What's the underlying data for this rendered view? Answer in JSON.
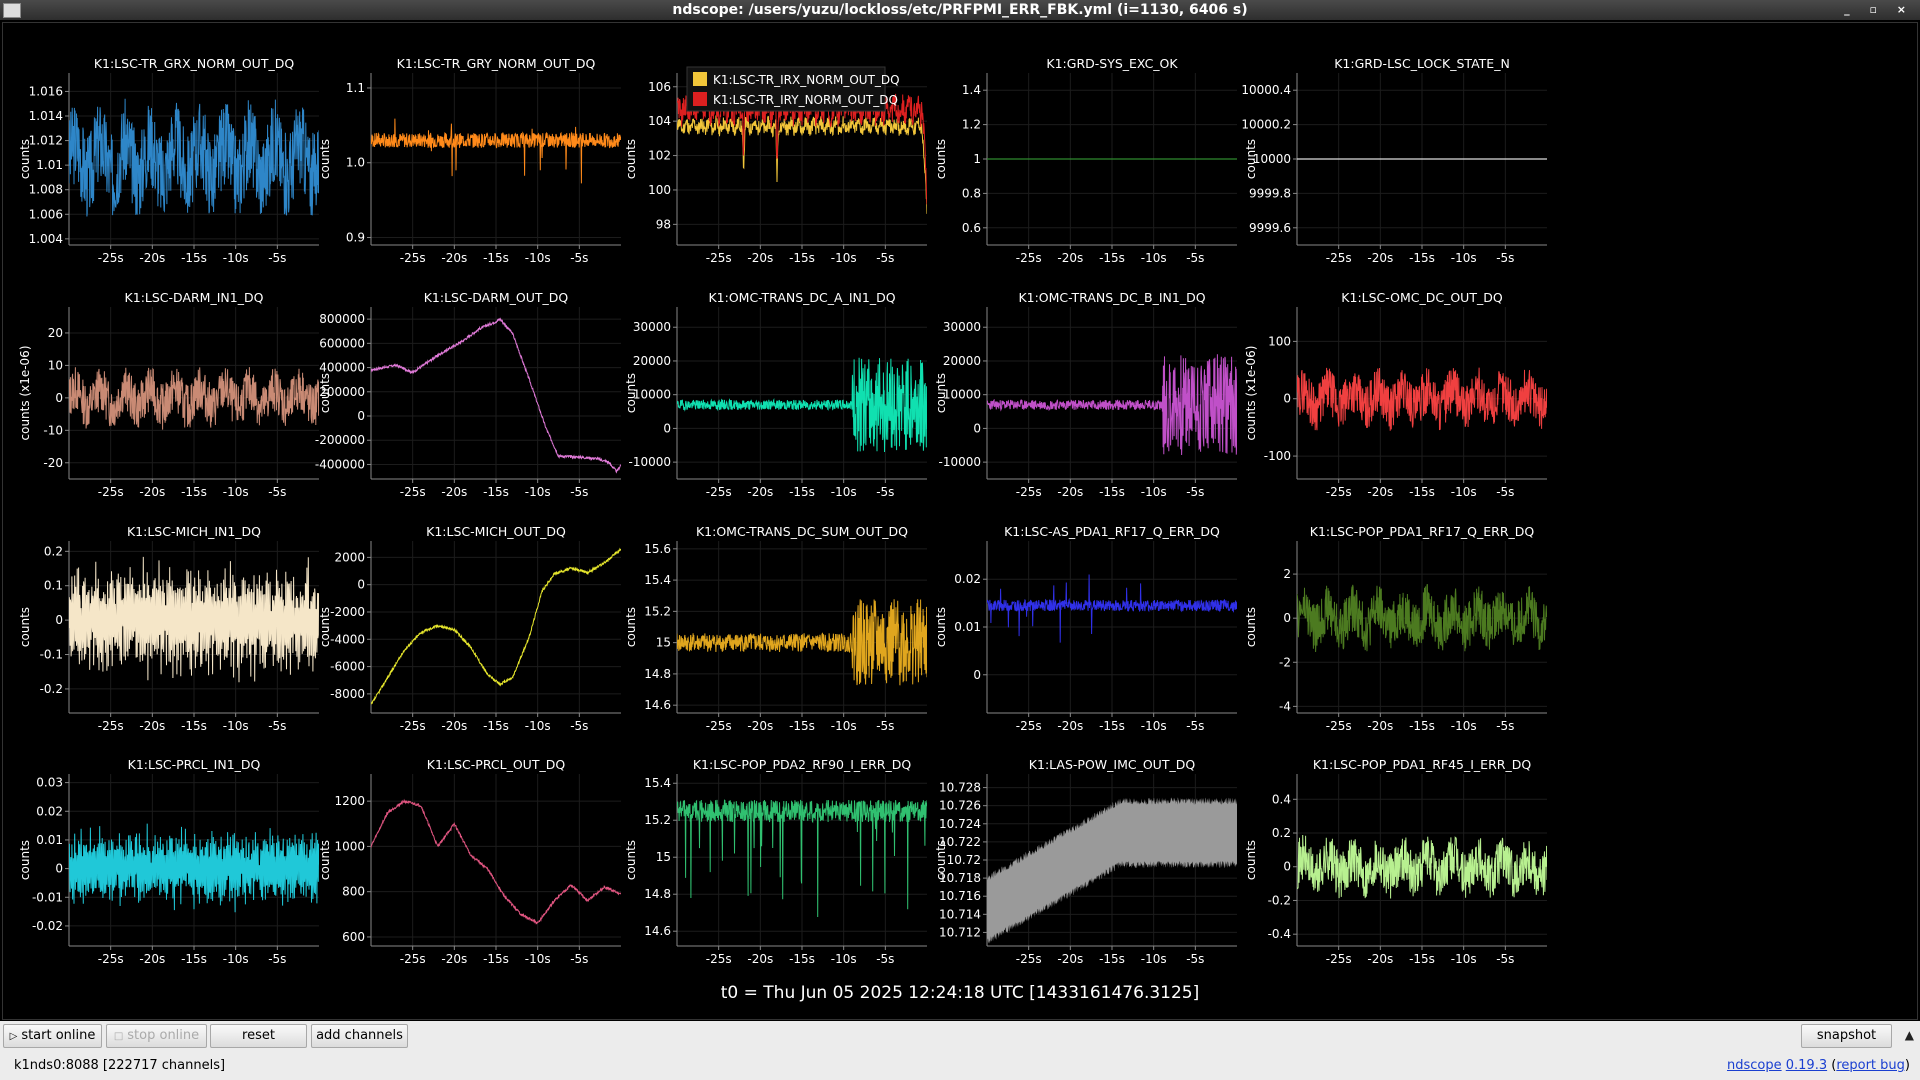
{
  "window": {
    "title": "ndscope: /users/yuzu/lockloss/etc/PRFPMI_ERR_FBK.yml (i=1130, 6406 s)",
    "controls": "_ ▫ ×"
  },
  "t0_label": "t0 = Thu Jun 05 2025 12:24:18 UTC [1433161476.3125]",
  "x_axis": {
    "min": -30,
    "max": 0,
    "ticks": [
      "-25s",
      "-20s",
      "-15s",
      "-10s",
      "-5s"
    ],
    "tick_values": [
      -25,
      -20,
      -15,
      -10,
      -5
    ]
  },
  "toolbar": {
    "start_online": "start online",
    "stop_online": "stop online",
    "reset": "reset",
    "add_channels": "add channels",
    "snapshot": "snapshot",
    "collapse": "▲"
  },
  "status": {
    "server": "k1nds0:8088  [222717 channels]",
    "app": "ndscope",
    "version": "0.19.3",
    "report": "report bug"
  },
  "plots": [
    {
      "id": "grx",
      "title": "K1:LSC-TR_GRX_NORM_OUT_DQ",
      "ylabel": "counts",
      "color": "#2e86c8",
      "ylim": [
        1.0035,
        1.0175
      ],
      "ticks": [
        "1.004",
        "1.006",
        "1.008",
        "1.01",
        "1.012",
        "1.014",
        "1.016"
      ],
      "tick_values": [
        1.004,
        1.006,
        1.008,
        1.01,
        1.012,
        1.014,
        1.016
      ],
      "kind": "noise",
      "base": 1.0105,
      "amp": 0.0035,
      "seed": 3
    },
    {
      "id": "gry",
      "title": "K1:LSC-TR_GRY_NORM_OUT_DQ",
      "ylabel": "counts",
      "color": "#ff8a1a",
      "ylim": [
        0.89,
        1.12
      ],
      "ticks": [
        "0.9",
        "1.0",
        "1.1"
      ],
      "tick_values": [
        0.9,
        1.0,
        1.1
      ],
      "kind": "noise_spiky",
      "base": 1.03,
      "amp": 0.01,
      "seed": 7
    },
    {
      "id": "tr",
      "title": "",
      "ylabel": "counts",
      "color": "#ffd23a",
      "ylim": [
        96.8,
        106.8
      ],
      "ticks": [
        "98",
        "100",
        "102",
        "104",
        "106"
      ],
      "tick_values": [
        98,
        100,
        102,
        104,
        106
      ],
      "kind": "dual",
      "legend": [
        {
          "name": "K1:LSC-TR_IRX_NORM_OUT_DQ",
          "color": "#f2c63a"
        },
        {
          "name": "K1:LSC-TR_IRY_NORM_OUT_DQ",
          "color": "#dd2020"
        }
      ],
      "series": [
        {
          "name": "K1:LSC-TR_IRX_NORM_OUT_DQ",
          "color": "#f2c63a",
          "base": 103.7,
          "amp": 0.4
        },
        {
          "name": "K1:LSC-TR_IRY_NORM_OUT_DQ",
          "color": "#dd2020",
          "base": 104.7,
          "amp": 0.7
        }
      ],
      "seed": 11
    },
    {
      "id": "sysexc",
      "title": "K1:GRD-SYS_EXC_OK",
      "ylabel": "counts",
      "color": "#2f8a2f",
      "ylim": [
        0.5,
        1.5
      ],
      "ticks": [
        "0.6",
        "0.8",
        "1",
        "1.2",
        "1.4"
      ],
      "tick_values": [
        0.6,
        0.8,
        1.0,
        1.2,
        1.4
      ],
      "kind": "flat",
      "base": 1.0,
      "seed": 0
    },
    {
      "id": "lockstate",
      "title": "K1:GRD-LSC_LOCK_STATE_N",
      "ylabel": "counts",
      "color": "#dddddd",
      "ylim": [
        9999.5,
        10000.5
      ],
      "ticks": [
        "9999.6",
        "9999.8",
        "10000",
        "10000.2",
        "10000.4"
      ],
      "tick_values": [
        9999.6,
        9999.8,
        10000.0,
        10000.2,
        10000.4
      ],
      "kind": "flat",
      "base": 10000,
      "seed": 0
    },
    {
      "id": "darmin",
      "title": "K1:LSC-DARM_IN1_DQ",
      "ylabel": "counts (x1e-06)",
      "color": "#c98a74",
      "ylim": [
        -25,
        28
      ],
      "ticks": [
        "-20",
        "-10",
        "0",
        "10",
        "20"
      ],
      "tick_values": [
        -20,
        -10,
        0,
        10,
        20
      ],
      "kind": "noise",
      "base": 0,
      "amp": 7,
      "seed": 13
    },
    {
      "id": "darmout",
      "title": "K1:LSC-DARM_OUT_DQ",
      "ylabel": "counts",
      "color": "#e07ad8",
      "ylim": [
        -520000,
        900000
      ],
      "ticks": [
        "-400000",
        "-200000",
        "0",
        "200000",
        "400000",
        "600000",
        "800000"
      ],
      "tick_values": [
        -400000,
        -200000,
        0,
        200000,
        400000,
        600000,
        800000
      ],
      "kind": "path",
      "path": [
        [
          -30,
          380000
        ],
        [
          -27,
          420000
        ],
        [
          -25,
          360000
        ],
        [
          -22,
          500000
        ],
        [
          -19,
          620000
        ],
        [
          -17,
          720000
        ],
        [
          -15,
          780000
        ],
        [
          -14.5,
          800000
        ],
        [
          -13,
          680000
        ],
        [
          -11,
          300000
        ],
        [
          -9,
          -100000
        ],
        [
          -7.5,
          -330000
        ],
        [
          -5,
          -340000
        ],
        [
          -3,
          -350000
        ],
        [
          -1.5,
          -380000
        ],
        [
          -0.5,
          -460000
        ],
        [
          0,
          -400000
        ]
      ],
      "seed": 17
    },
    {
      "id": "omca",
      "title": "K1:OMC-TRANS_DC_A_IN1_DQ",
      "ylabel": "counts",
      "color": "#10e0b0",
      "ylim": [
        -15000,
        36000
      ],
      "ticks": [
        "-10000",
        "0",
        "10000",
        "20000",
        "30000"
      ],
      "tick_values": [
        -10000,
        0,
        10000,
        20000,
        30000
      ],
      "kind": "burst",
      "base": 7000,
      "amp": 1500,
      "burst_at": -9,
      "burst_amp": 14000,
      "seed": 19
    },
    {
      "id": "omcb",
      "title": "K1:OMC-TRANS_DC_B_IN1_DQ",
      "ylabel": "counts",
      "color": "#c050c8",
      "ylim": [
        -15000,
        36000
      ],
      "ticks": [
        "-10000",
        "0",
        "10000",
        "20000",
        "30000"
      ],
      "tick_values": [
        -10000,
        0,
        10000,
        20000,
        30000
      ],
      "kind": "burst",
      "base": 7000,
      "amp": 1500,
      "burst_at": -9,
      "burst_amp": 15000,
      "seed": 23
    },
    {
      "id": "omcdc",
      "title": "K1:LSC-OMC_DC_OUT_DQ",
      "ylabel": "counts (x1e-06)",
      "color": "#f04040",
      "ylim": [
        -140,
        160
      ],
      "ticks": [
        "-100",
        "0",
        "100"
      ],
      "tick_values": [
        -100,
        0,
        100
      ],
      "kind": "noise",
      "base": 0,
      "amp": 40,
      "seed": 29
    },
    {
      "id": "michin",
      "title": "K1:LSC-MICH_IN1_DQ",
      "ylabel": "counts",
      "color": "#f5e6c8",
      "ylim": [
        -0.27,
        0.23
      ],
      "ticks": [
        "-0.2",
        "-0.1",
        "0",
        "0.1",
        "0.2"
      ],
      "tick_values": [
        -0.2,
        -0.1,
        0,
        0.1,
        0.2
      ],
      "kind": "osc",
      "base": 0,
      "amp": 0.13,
      "seed": 31
    },
    {
      "id": "michout",
      "title": "K1:LSC-MICH_OUT_DQ",
      "ylabel": "counts",
      "color": "#e6e62c",
      "ylim": [
        -9400,
        3200
      ],
      "ticks": [
        "-8000",
        "-6000",
        "-4000",
        "-2000",
        "0",
        "2000"
      ],
      "tick_values": [
        -8000,
        -6000,
        -4000,
        -2000,
        0,
        2000
      ],
      "kind": "path",
      "path": [
        [
          -30,
          -8800
        ],
        [
          -28,
          -6800
        ],
        [
          -26,
          -4800
        ],
        [
          -24,
          -3500
        ],
        [
          -22,
          -3000
        ],
        [
          -20,
          -3300
        ],
        [
          -18,
          -4600
        ],
        [
          -16,
          -6600
        ],
        [
          -14.5,
          -7300
        ],
        [
          -13,
          -6800
        ],
        [
          -11,
          -3800
        ],
        [
          -9.5,
          -500
        ],
        [
          -8,
          800
        ],
        [
          -6,
          1200
        ],
        [
          -4,
          900
        ],
        [
          -2,
          1600
        ],
        [
          0,
          2600
        ]
      ],
      "seed": 37
    },
    {
      "id": "omcsum",
      "title": "K1:OMC-TRANS_DC_SUM_OUT_DQ",
      "ylabel": "counts",
      "color": "#e0a61e",
      "ylim": [
        14.55,
        15.65
      ],
      "ticks": [
        "14.6",
        "14.8",
        "15",
        "15.2",
        "15.4",
        "15.6"
      ],
      "tick_values": [
        14.6,
        14.8,
        15.0,
        15.2,
        15.4,
        15.6
      ],
      "kind": "burst",
      "base": 15.0,
      "amp": 0.06,
      "burst_at": -9,
      "burst_amp": 0.28,
      "seed": 41
    },
    {
      "id": "aspda",
      "title": "K1:LSC-AS_PDA1_RF17_Q_ERR_DQ",
      "ylabel": "counts",
      "color": "#3030e8",
      "ylim": [
        -0.008,
        0.028
      ],
      "ticks": [
        "0",
        "0.01",
        "0.02"
      ],
      "tick_values": [
        0,
        0.01,
        0.02
      ],
      "kind": "noise_spiky",
      "base": 0.0145,
      "amp": 0.0012,
      "seed": 43
    },
    {
      "id": "poppda17",
      "title": "K1:LSC-POP_PDA1_RF17_Q_ERR_DQ",
      "ylabel": "counts",
      "color": "#4c7a20",
      "ylim": [
        -4.3,
        3.5
      ],
      "ticks": [
        "-4",
        "-2",
        "0",
        "2"
      ],
      "tick_values": [
        -4,
        -2,
        0,
        2
      ],
      "kind": "noise",
      "base": 0,
      "amp": 1.1,
      "seed": 47
    },
    {
      "id": "prclin",
      "title": "K1:LSC-PRCL_IN1_DQ",
      "ylabel": "counts",
      "color": "#20c8d8",
      "ylim": [
        -0.027,
        0.033
      ],
      "ticks": [
        "-0.02",
        "-0.01",
        "0",
        "0.01",
        "0.02",
        "0.03"
      ],
      "tick_values": [
        -0.02,
        -0.01,
        0,
        0.01,
        0.02,
        0.03
      ],
      "kind": "osc",
      "base": 0,
      "amp": 0.011,
      "seed": 53
    },
    {
      "id": "prclout",
      "title": "K1:LSC-PRCL_OUT_DQ",
      "ylabel": "counts",
      "color": "#e05580",
      "ylim": [
        560,
        1320
      ],
      "ticks": [
        "600",
        "800",
        "1000",
        "1200"
      ],
      "tick_values": [
        600,
        800,
        1000,
        1200
      ],
      "kind": "path",
      "path": [
        [
          -30,
          1000
        ],
        [
          -28,
          1150
        ],
        [
          -26,
          1200
        ],
        [
          -24,
          1180
        ],
        [
          -22,
          1000
        ],
        [
          -20,
          1100
        ],
        [
          -18,
          960
        ],
        [
          -16,
          900
        ],
        [
          -14,
          780
        ],
        [
          -12,
          700
        ],
        [
          -10,
          660
        ],
        [
          -8,
          760
        ],
        [
          -6,
          830
        ],
        [
          -4,
          760
        ],
        [
          -2,
          820
        ],
        [
          0,
          790
        ]
      ],
      "seed": 59
    },
    {
      "id": "poppda2",
      "title": "K1:LSC-POP_PDA2_RF90_I_ERR_DQ",
      "ylabel": "counts",
      "color": "#30c070",
      "ylim": [
        14.52,
        15.45
      ],
      "ticks": [
        "14.6",
        "14.8",
        "15",
        "15.2",
        "15.4"
      ],
      "tick_values": [
        14.6,
        14.8,
        15.0,
        15.2,
        15.4
      ],
      "kind": "noise_dips",
      "base": 15.25,
      "amp": 0.06,
      "seed": 61
    },
    {
      "id": "lasimc",
      "title": "K1:LAS-POW_IMC_OUT_DQ",
      "ylabel": "counts",
      "color": "#9a9a9a",
      "ylim": [
        10.7105,
        10.7295
      ],
      "ticks": [
        "10.712",
        "10.714",
        "10.716",
        "10.718",
        "10.72",
        "10.722",
        "10.724",
        "10.726",
        "10.728"
      ],
      "tick_values": [
        10.712,
        10.714,
        10.716,
        10.718,
        10.72,
        10.722,
        10.724,
        10.726,
        10.728
      ],
      "kind": "band",
      "seed": 67
    },
    {
      "id": "poppda45",
      "title": "K1:LSC-POP_PDA1_RF45_I_ERR_DQ",
      "ylabel": "counts",
      "color": "#b8f090",
      "ylim": [
        -0.47,
        0.55
      ],
      "ticks": [
        "-0.4",
        "-0.2",
        "0",
        "0.2",
        "0.4"
      ],
      "tick_values": [
        -0.4,
        -0.2,
        0,
        0.2,
        0.4
      ],
      "kind": "noise",
      "base": 0,
      "amp": 0.14,
      "seed": 71
    }
  ]
}
